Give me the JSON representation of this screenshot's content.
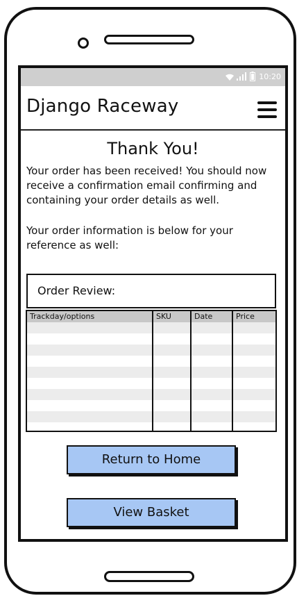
{
  "statusbar": {
    "time": "10:20"
  },
  "appbar": {
    "title": "Django Raceway"
  },
  "main": {
    "heading": "Thank You!",
    "paragraph1": "Your order has been received! You should now receive a confirmation email confirming and containing your order details as well.",
    "paragraph2": "Your order information is below for your reference as well:"
  },
  "order_review": {
    "title": "Order Review:",
    "columns": [
      "Trackday/options",
      "SKU",
      "Date",
      "Price"
    ]
  },
  "buttons": {
    "return_home": "Return to Home",
    "view_basket": "View Basket"
  }
}
